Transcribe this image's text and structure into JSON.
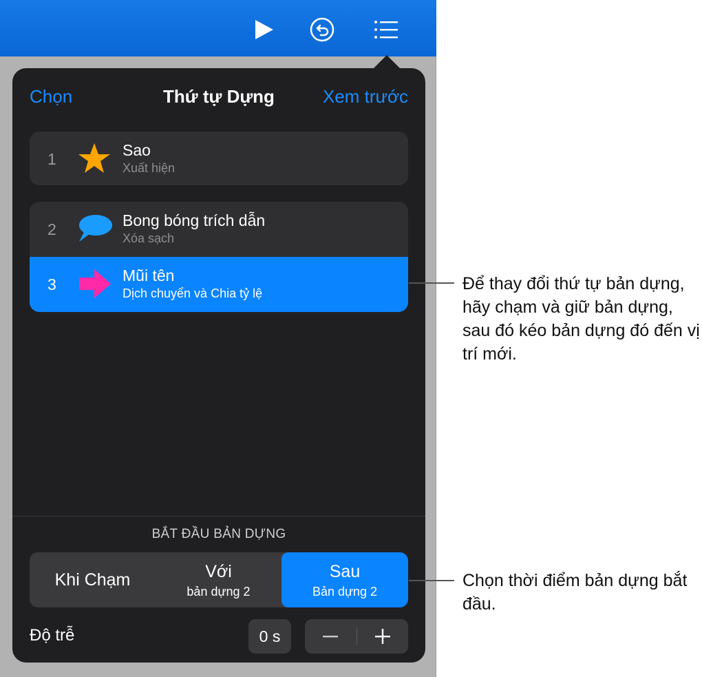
{
  "toolbar": {
    "icons": [
      "play-icon",
      "undo-icon",
      "list-icon"
    ],
    "color": "#0a67d6"
  },
  "popover": {
    "choose_label": "Chọn",
    "title": "Thứ tự Dựng",
    "preview_label": "Xem trước"
  },
  "builds": [
    {
      "number": "1",
      "title": "Sao",
      "subtitle": "Xuất hiện",
      "icon": "star-icon",
      "icon_color": "#ffa500",
      "selected": false
    },
    {
      "number": "2",
      "title": "Bong bóng trích dẫn",
      "subtitle": "Xóa sạch",
      "icon": "speech-bubble-icon",
      "icon_color": "#1a9cff",
      "selected": false
    },
    {
      "number": "3",
      "title": "Mũi tên",
      "subtitle": "Dịch chuyển và Chia tỷ lệ",
      "icon": "arrow-icon",
      "icon_color": "#ff2aa8",
      "selected": true
    }
  ],
  "start": {
    "label": "BẮT ĐẦU BẢN DỰNG",
    "options": [
      {
        "label": "Khi Chạm",
        "sub": "",
        "selected": false
      },
      {
        "label": "Với",
        "sub": "bản dựng 2",
        "selected": false
      },
      {
        "label": "Sau",
        "sub": "Bản dựng 2",
        "selected": true
      }
    ]
  },
  "delay": {
    "label": "Độ trễ",
    "value": "0 s"
  },
  "callouts": {
    "reorder": "Để thay đổi thứ tự bản dựng, hãy chạm và giữ bản dựng, sau đó kéo bản dựng đó đến vị trí mới.",
    "start_time": "Chọn thời điểm bản dựng bắt đầu."
  },
  "colors": {
    "accent": "#0a84ff",
    "popover_bg": "#1f1f21"
  }
}
